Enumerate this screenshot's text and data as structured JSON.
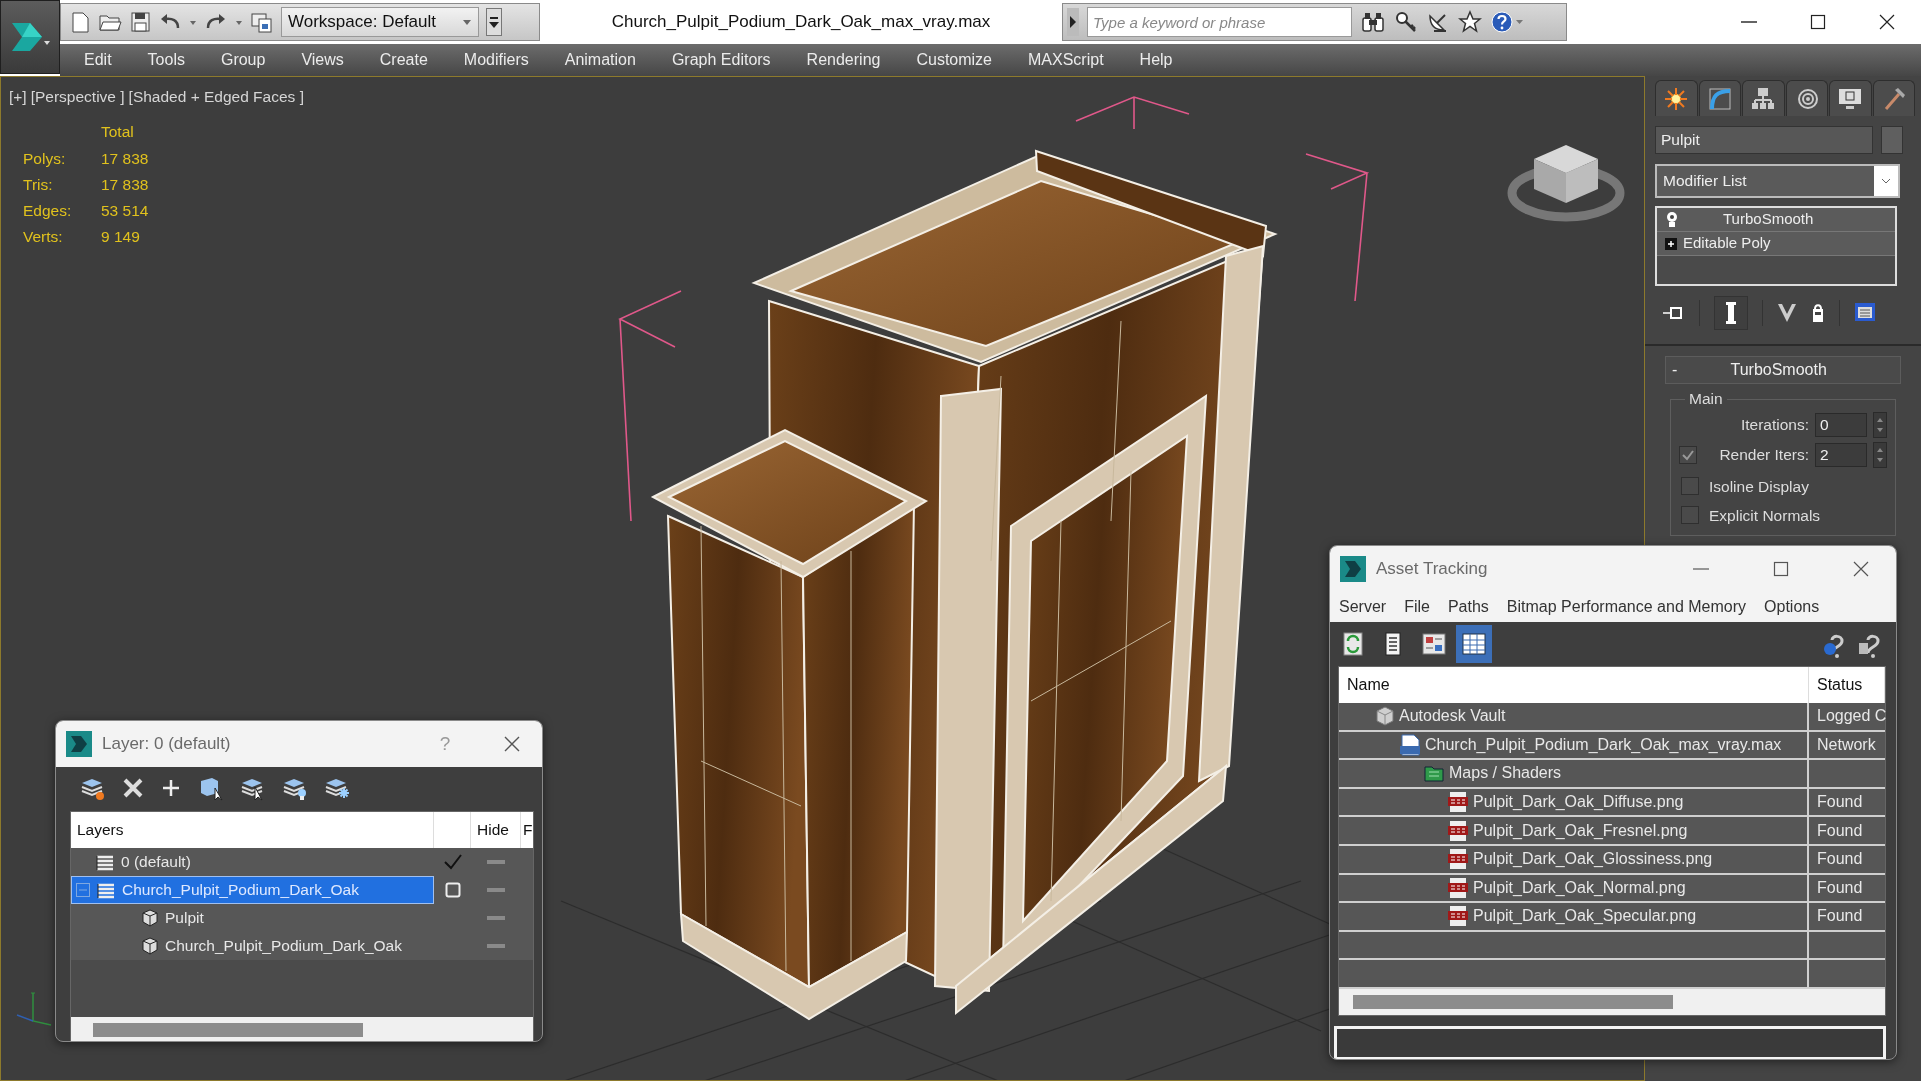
{
  "title_bar": {
    "workspace": "Workspace: Default",
    "document_title": "Church_Pulpit_Podium_Dark_Oak_max_vray.max",
    "search": {
      "placeholder": "Type a keyword or phrase"
    }
  },
  "menu_bar": [
    "Edit",
    "Tools",
    "Group",
    "Views",
    "Create",
    "Modifiers",
    "Animation",
    "Graph Editors",
    "Rendering",
    "Customize",
    "MAXScript",
    "Help"
  ],
  "viewport": {
    "labels": [
      "[+]",
      "[Perspective ]",
      "[Shaded + Edged Faces ]"
    ],
    "stats": {
      "header": "Total",
      "rows": [
        {
          "label": "Polys:",
          "value": "17 838"
        },
        {
          "label": "Tris:",
          "value": "17 838"
        },
        {
          "label": "Edges:",
          "value": "53 514"
        },
        {
          "label": "Verts:",
          "value": "9 149"
        }
      ]
    }
  },
  "command_panel": {
    "object_name": "Pulpit",
    "modifier_list": "Modifier List",
    "stack": [
      {
        "label": "TurboSmooth",
        "kind": "modifier"
      },
      {
        "label": "Editable Poly",
        "kind": "base"
      }
    ],
    "rollout": {
      "toggle": "-",
      "title": "TurboSmooth",
      "group": "Main",
      "spinners": [
        {
          "kind": "spinner",
          "label": "Iterations:",
          "value": "0"
        },
        {
          "kind": "check_spinner",
          "label": "Render Iters:",
          "value": "2",
          "checked": true
        }
      ],
      "checkboxes": [
        {
          "label": "Isoline Display",
          "checked": false
        },
        {
          "label": "Explicit Normals",
          "checked": false
        }
      ]
    }
  },
  "layer_dialog": {
    "title": "Layer: 0 (default)",
    "help": "?",
    "columns": {
      "layers": "Layers",
      "hide": "Hide",
      "column_4": "F"
    },
    "rows": [
      {
        "kind": "layer",
        "label": "0 (default)",
        "current": true,
        "selected": false
      },
      {
        "kind": "layer",
        "label": "Church_Pulpit_Podium_Dark_Oak",
        "current": false,
        "selected": true,
        "expanded": true,
        "children": [
          {
            "kind": "object",
            "label": "Pulpit",
            "selected": false
          },
          {
            "kind": "object",
            "label": "Church_Pulpit_Podium_Dark_Oak",
            "selected": false
          }
        ]
      }
    ]
  },
  "asset_tracking": {
    "title": "Asset Tracking",
    "menu": [
      "Server",
      "File",
      "Paths",
      "Bitmap Performance and Memory",
      "Options"
    ],
    "toolbar": [
      {
        "selected": false
      },
      {
        "selected": false
      },
      {
        "selected": false
      },
      {
        "selected": true
      }
    ],
    "columns": [
      "Name",
      "Status"
    ],
    "rows": [
      {
        "kind": "vault",
        "name": "Autodesk Vault",
        "status": "Logged C",
        "children": [
          {
            "kind": "max",
            "name": "Church_Pulpit_Podium_Dark_Oak_max_vray.max",
            "status": "Network",
            "children": [
              {
                "kind": "folder",
                "name": "Maps / Shaders",
                "children": [
                  {
                    "kind": "png",
                    "name": "Pulpit_Dark_Oak_Diffuse.png",
                    "status": "Found"
                  },
                  {
                    "kind": "png",
                    "name": "Pulpit_Dark_Oak_Fresnel.png",
                    "status": "Found"
                  },
                  {
                    "kind": "png",
                    "name": "Pulpit_Dark_Oak_Glossiness.png",
                    "status": "Found"
                  },
                  {
                    "kind": "png",
                    "name": "Pulpit_Dark_Oak_Normal.png",
                    "status": "Found"
                  },
                  {
                    "kind": "png",
                    "name": "Pulpit_Dark_Oak_Specular.png",
                    "status": "Found"
                  }
                ]
              }
            ]
          }
        ]
      }
    ]
  }
}
